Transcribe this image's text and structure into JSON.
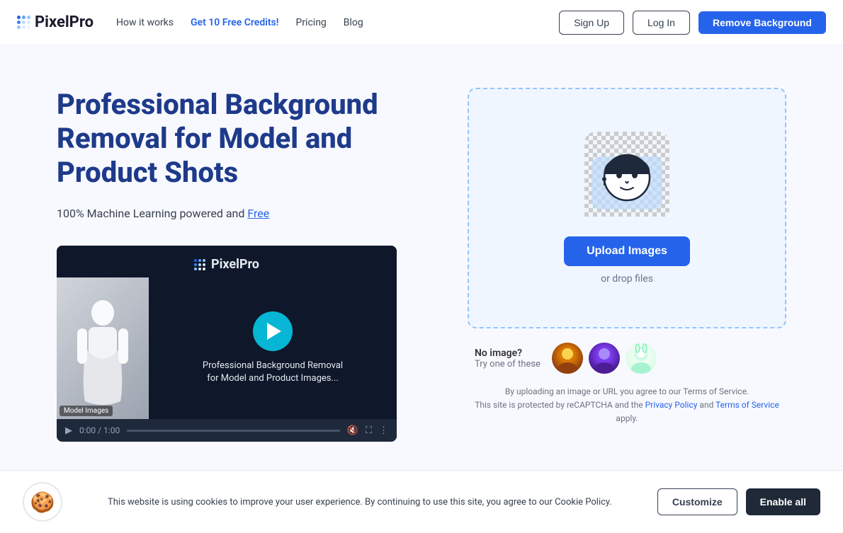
{
  "navbar": {
    "logo_text": "PixelPro",
    "nav_links": [
      {
        "id": "how-it-works",
        "label": "How it works",
        "promo": false
      },
      {
        "id": "get-credits",
        "label": "Get 10 Free Credits!",
        "promo": true
      },
      {
        "id": "pricing",
        "label": "Pricing",
        "promo": false
      },
      {
        "id": "blog",
        "label": "Blog",
        "promo": false
      }
    ],
    "sign_up_label": "Sign Up",
    "log_in_label": "Log In",
    "remove_bg_label": "Remove Background"
  },
  "hero": {
    "title": "Professional Background Removal for Model and Product Shots",
    "subtitle_text": "100% Machine Learning powered and ",
    "subtitle_free": "Free",
    "video": {
      "logo_text": "PixelPro",
      "caption_line1": "Professional Background Removal",
      "caption_line2": "for Model and Product Images...",
      "model_label": "Model Images",
      "time_current": "0:00",
      "time_total": "1:00"
    },
    "upload": {
      "button_label": "Upload Images",
      "drop_label": "or drop files"
    },
    "try_these": {
      "no_image_label": "No image?",
      "try_label": "Try one of these"
    },
    "legal_line1": "By uploading an image or URL you agree to our Terms of Service.",
    "legal_line2_before": "This site is protected by reCAPTCHA and the ",
    "privacy_policy": "Privacy Policy",
    "legal_and": " and ",
    "terms_of_service": "Terms of Service",
    "legal_line2_after": " apply."
  },
  "cookie": {
    "icon": "🍪",
    "text": "This website is using cookies to improve your user experience. By continuing to use this site, you agree to our Cookie Policy.",
    "customize_label": "Customize",
    "enable_label": "Enable all"
  }
}
